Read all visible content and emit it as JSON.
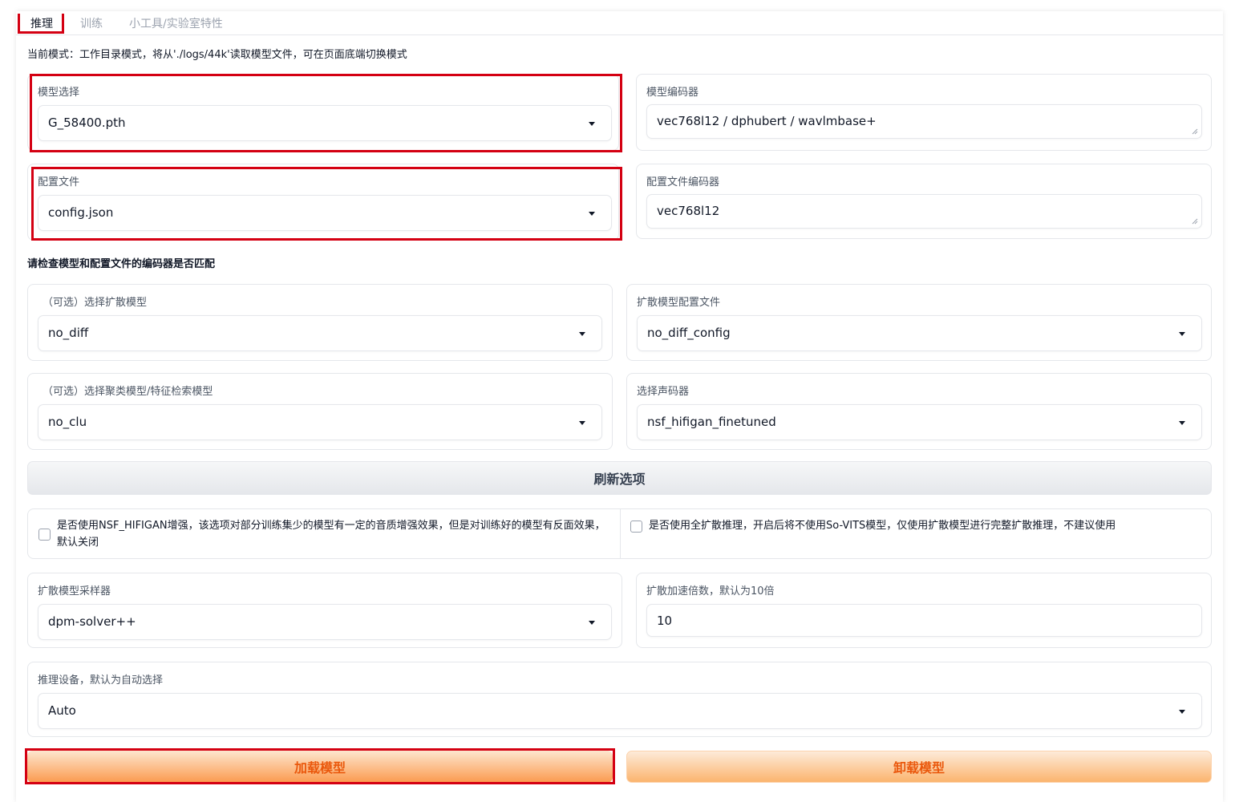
{
  "tabs": [
    {
      "label": "推理"
    },
    {
      "label": "训练"
    },
    {
      "label": "小工具/实验室特性"
    }
  ],
  "mode_text": "当前模式：工作目录模式，将从'./logs/44k'读取模型文件，可在页面底端切换模式",
  "model_select": {
    "label": "模型选择",
    "value": "G_58400.pth"
  },
  "model_encoder": {
    "label": "模型编码器",
    "value": "vec768l12 / dphubert / wavlmbase+"
  },
  "config_file": {
    "label": "配置文件",
    "value": "config.json"
  },
  "config_encoder": {
    "label": "配置文件编码器",
    "value": "vec768l12"
  },
  "encoder_warning": "请检查模型和配置文件的编码器是否匹配",
  "diff_model": {
    "label": "（可选）选择扩散模型",
    "value": "no_diff"
  },
  "diff_config": {
    "label": "扩散模型配置文件",
    "value": "no_diff_config"
  },
  "cluster_model": {
    "label": "（可选）选择聚类模型/特征检索模型",
    "value": "no_clu"
  },
  "vocoder": {
    "label": "选择声码器",
    "value": "nsf_hifigan_finetuned"
  },
  "refresh_button": "刷新选项",
  "nsf_enhance": {
    "label": "是否使用NSF_HIFIGAN增强，该选项对部分训练集少的模型有一定的音质增强效果，但是对训练好的模型有反面效果，默认关闭",
    "checked": false
  },
  "full_diffusion": {
    "label": "是否使用全扩散推理，开启后将不使用So-VITS模型，仅使用扩散模型进行完整扩散推理，不建议使用",
    "checked": false
  },
  "diff_sampler": {
    "label": "扩散模型采样器",
    "value": "dpm-solver++"
  },
  "diff_speedup": {
    "label": "扩散加速倍数，默认为10倍",
    "value": "10"
  },
  "device": {
    "label": "推理设备，默认为自动选择",
    "value": "Auto"
  },
  "load_button": "加载模型",
  "unload_button": "卸载模型",
  "colors": {
    "accent_orange": "#ea580c",
    "highlight_red": "#d40012"
  }
}
